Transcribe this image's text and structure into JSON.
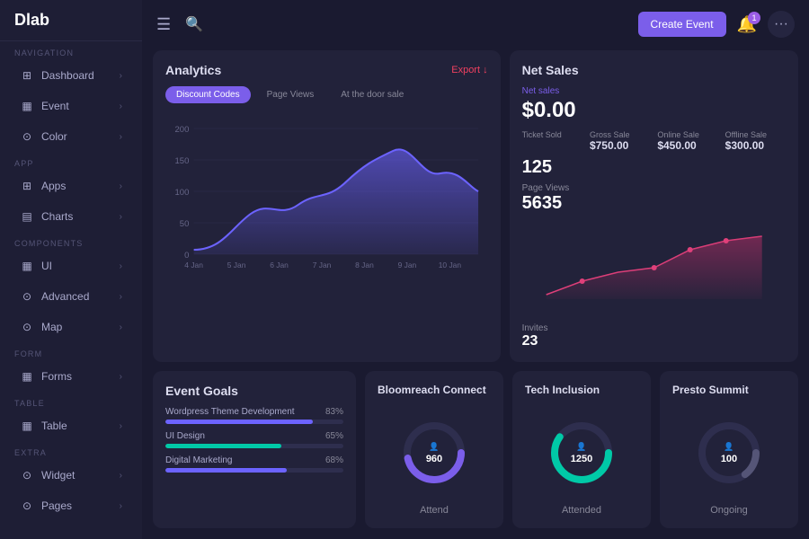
{
  "app": {
    "name": "Dlab"
  },
  "header": {
    "create_event_label": "Create Event",
    "notif_count": "1",
    "more_icon": "•••"
  },
  "sidebar": {
    "sections": [
      {
        "label": "NAVIGATION",
        "items": [
          {
            "id": "dashboard",
            "icon": "⊞",
            "label": "Dashboard"
          },
          {
            "id": "event",
            "icon": "▦",
            "label": "Event"
          },
          {
            "id": "color",
            "icon": "⊙",
            "label": "Color"
          }
        ]
      },
      {
        "label": "APP",
        "items": [
          {
            "id": "apps",
            "icon": "⊞",
            "label": "Apps"
          },
          {
            "id": "charts",
            "icon": "▤",
            "label": "Charts"
          }
        ]
      },
      {
        "label": "COMPONENTS",
        "items": [
          {
            "id": "ui",
            "icon": "▦",
            "label": "UI"
          },
          {
            "id": "advanced",
            "icon": "⊙",
            "label": "Advanced"
          },
          {
            "id": "map",
            "icon": "⊙",
            "label": "Map"
          }
        ]
      },
      {
        "label": "FORM",
        "items": [
          {
            "id": "forms",
            "icon": "▦",
            "label": "Forms"
          }
        ]
      },
      {
        "label": "TABLE",
        "items": [
          {
            "id": "table",
            "icon": "▦",
            "label": "Table"
          }
        ]
      },
      {
        "label": "EXTRA",
        "items": [
          {
            "id": "widget",
            "icon": "⊙",
            "label": "Widget"
          },
          {
            "id": "pages",
            "icon": "⊙",
            "label": "Pages"
          }
        ]
      }
    ]
  },
  "analytics": {
    "title": "Analytics",
    "export_label": "Export ↓",
    "tabs": [
      "Discount Codes",
      "Page Views",
      "At the door sale"
    ],
    "active_tab": 0,
    "y_labels": [
      "200",
      "150",
      "100",
      "50",
      "0"
    ],
    "x_labels": [
      "4 Jan",
      "5 Jan",
      "6 Jan",
      "7 Jan",
      "8 Jan",
      "9 Jan",
      "10 Jan"
    ]
  },
  "net_sales": {
    "title": "Net Sales",
    "net_sales_label": "Net sales",
    "net_sales_value": "$0.00",
    "gross_sale": {
      "label": "Gross Sale",
      "value": "$750.00"
    },
    "online_sale": {
      "label": "Online Sale",
      "value": "$450.00"
    },
    "offline_sale": {
      "label": "Offline Sale",
      "value": "$300.00"
    },
    "ticket_sold": {
      "label": "Ticket Sold",
      "value": "125"
    },
    "page_views": {
      "label": "Page Views",
      "value": "5635"
    },
    "invites": {
      "label": "Invites",
      "value": "23"
    }
  },
  "event_goals": {
    "title": "Event Goals",
    "goals": [
      {
        "label": "Wordpress Theme Development",
        "pct": 83,
        "pct_label": "83%",
        "color": "#6c63ff"
      },
      {
        "label": "UI Design",
        "pct": 65,
        "pct_label": "65%",
        "color": "#00c9a7"
      },
      {
        "label": "Digital Marketing",
        "pct": 68,
        "pct_label": "68%",
        "color": "#6c63ff"
      }
    ]
  },
  "bloomreach": {
    "title": "Bloomreach Connect",
    "count": "960",
    "count_icon": "👤",
    "status": "Attend",
    "donut_color": "#7b5eea",
    "donut_pct": 72
  },
  "tech_inclusion": {
    "title": "Tech Inclusion",
    "count": "1250",
    "count_icon": "👤",
    "status": "Attended",
    "donut_color": "#00c9a7",
    "donut_pct": 85
  },
  "presto_summit": {
    "title": "Presto Summit",
    "count": "100",
    "count_icon": "👤",
    "status": "Ongoing",
    "donut_color": "#555577",
    "donut_pct": 40
  }
}
